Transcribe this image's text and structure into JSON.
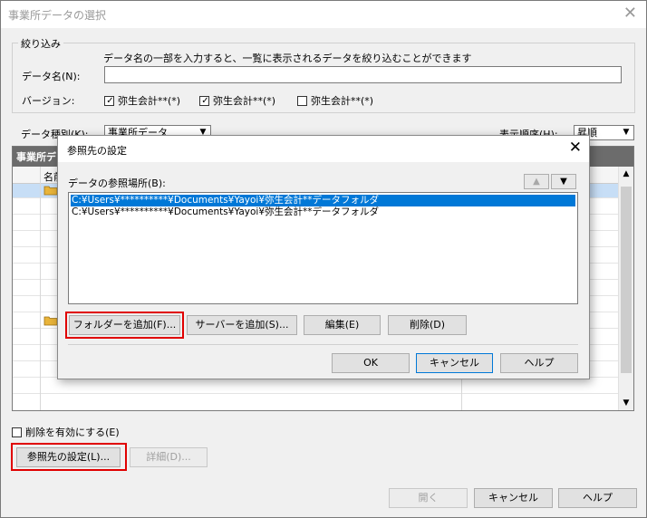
{
  "window": {
    "title": "事業所データの選択"
  },
  "filter": {
    "group_label": "絞り込み",
    "hint": "データ名の一部を入力すると、一覧に表示されるデータを絞り込むことができます",
    "data_name_label": "データ名(N):",
    "data_name_value": "",
    "version_label": "バージョン:",
    "versions": [
      {
        "label": "弥生会計**(*)",
        "checked": true
      },
      {
        "label": "弥生会計**(*)",
        "checked": true
      },
      {
        "label": "弥生会計**(*)",
        "checked": false
      }
    ]
  },
  "data_type": {
    "label": "データ種別(K):",
    "value": "事業所データ"
  },
  "sort": {
    "label": "表示順序(H):",
    "value": "昇順"
  },
  "grid": {
    "header": "事業所デ",
    "col_name": "名前"
  },
  "delete_enable": {
    "label": "削除を有効にする(E)",
    "checked": false
  },
  "buttons": {
    "ref_settings": "参照先の設定(L)...",
    "details": "詳細(D)...",
    "open": "開く",
    "cancel": "キャンセル",
    "help": "ヘルプ"
  },
  "dialog": {
    "title": "参照先の設定",
    "location_label": "データの参照場所(B):",
    "items": [
      "C:¥Users¥**********¥Documents¥Yayoi¥弥生会計**データフォルダ",
      "C:¥Users¥**********¥Documents¥Yayoi¥弥生会計**データフォルダ"
    ],
    "buttons": {
      "add_folder": "フォルダーを追加(F)...",
      "add_server": "サーバーを追加(S)...",
      "edit": "編集(E)",
      "delete": "削除(D)",
      "ok": "OK",
      "cancel": "キャンセル",
      "help": "ヘルプ"
    }
  }
}
